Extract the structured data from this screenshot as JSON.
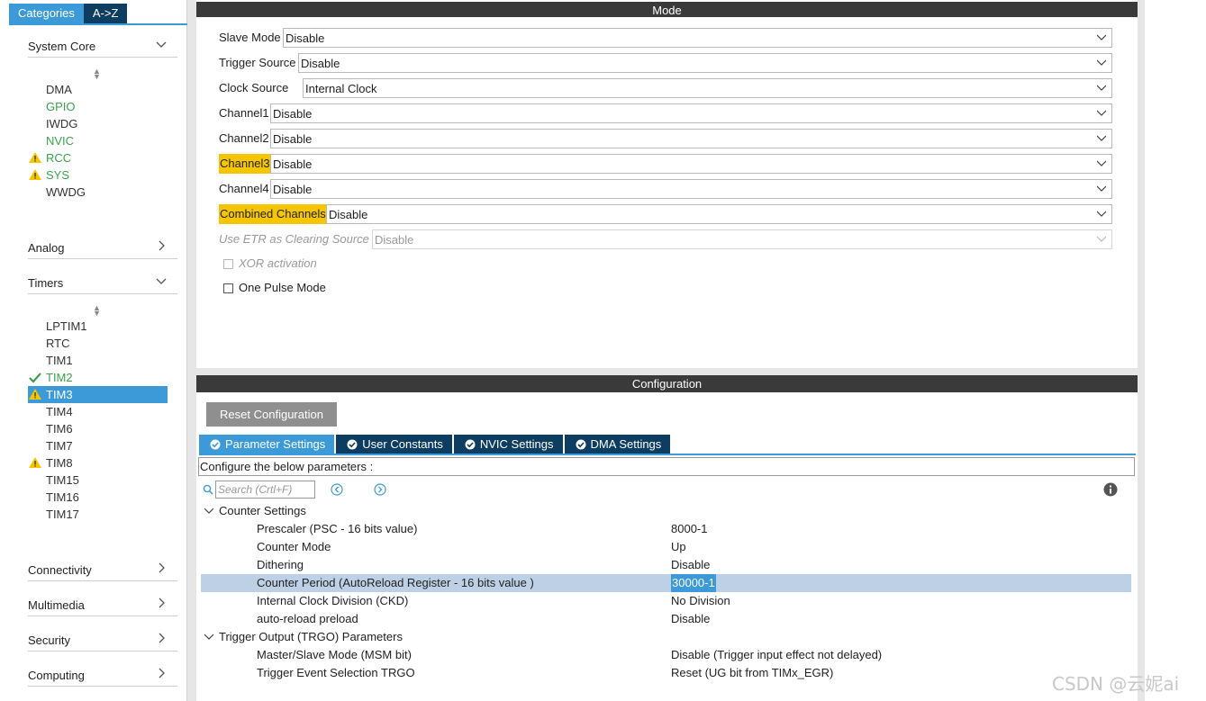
{
  "left_panel": {
    "tabs": [
      "Categories",
      "A->Z"
    ],
    "categories": {
      "system_core": "System Core",
      "analog": "Analog",
      "timers": "Timers",
      "connectivity": "Connectivity",
      "multimedia": "Multimedia",
      "security": "Security",
      "computing": "Computing"
    },
    "system_core_items": [
      {
        "label": "DMA",
        "status": "none"
      },
      {
        "label": "GPIO",
        "status": "green"
      },
      {
        "label": "IWDG",
        "status": "none"
      },
      {
        "label": "NVIC",
        "status": "green"
      },
      {
        "label": "RCC",
        "status": "warning"
      },
      {
        "label": "SYS",
        "status": "warning"
      },
      {
        "label": "WWDG",
        "status": "none"
      }
    ],
    "timer_items": [
      {
        "label": "LPTIM1",
        "status": "none"
      },
      {
        "label": "RTC",
        "status": "none"
      },
      {
        "label": "TIM1",
        "status": "none"
      },
      {
        "label": "TIM2",
        "status": "ok"
      },
      {
        "label": "TIM3",
        "status": "warning-selected"
      },
      {
        "label": "TIM4",
        "status": "none"
      },
      {
        "label": "TIM6",
        "status": "none"
      },
      {
        "label": "TIM7",
        "status": "none"
      },
      {
        "label": "TIM8",
        "status": "warning"
      },
      {
        "label": "TIM15",
        "status": "none"
      },
      {
        "label": "TIM16",
        "status": "none"
      },
      {
        "label": "TIM17",
        "status": "none"
      }
    ]
  },
  "mode": {
    "header": "Mode",
    "rows": [
      {
        "label": "Slave Mode",
        "value": "Disable"
      },
      {
        "label": "Trigger Source",
        "value": "Disable"
      },
      {
        "label": "Clock Source",
        "value": "Internal Clock"
      },
      {
        "label": "Channel1",
        "value": "Disable"
      },
      {
        "label": "Channel2",
        "value": "Disable"
      },
      {
        "label": "Channel3",
        "value": "Disable"
      },
      {
        "label": "Channel4",
        "value": "Disable"
      },
      {
        "label": "Combined Channels",
        "value": "Disable"
      },
      {
        "label": "Use ETR as Clearing Source",
        "value": "Disable"
      }
    ],
    "xor_activation": "XOR activation",
    "one_pulse_mode": "One Pulse Mode"
  },
  "configuration": {
    "header": "Configuration",
    "reset_button": "Reset Configuration",
    "tabs": [
      "Parameter Settings",
      "User Constants",
      "NVIC Settings",
      "DMA Settings"
    ],
    "configure_text": "Configure the below parameters :",
    "search_placeholder": "Search (Crtl+F)",
    "groups": {
      "counter": "Counter Settings",
      "trgo": "Trigger Output (TRGO) Parameters"
    },
    "params": [
      {
        "name": "Prescaler (PSC - 16 bits value)",
        "value": "8000-1"
      },
      {
        "name": "Counter Mode",
        "value": "Up"
      },
      {
        "name": "Dithering",
        "value": "Disable"
      },
      {
        "name": "Counter Period (AutoReload Register - 16 bits value )",
        "value": "30000-1"
      },
      {
        "name": "Internal Clock Division (CKD)",
        "value": "No Division"
      },
      {
        "name": "auto-reload preload",
        "value": "Disable"
      },
      {
        "name": "Master/Slave Mode (MSM bit)",
        "value": "Disable (Trigger input effect not delayed)"
      },
      {
        "name": "Trigger Event Selection TRGO",
        "value": "Reset (UG bit from TIMx_EGR)"
      }
    ]
  },
  "watermark": "CSDN @云妮ai",
  "colors": {
    "accent": "#3c9ad8",
    "navy": "#0e3d62",
    "header": "#3a3a3a",
    "highlight": "#f5c500",
    "ok_green": "#3aa24a",
    "warning": "#f5c500"
  }
}
